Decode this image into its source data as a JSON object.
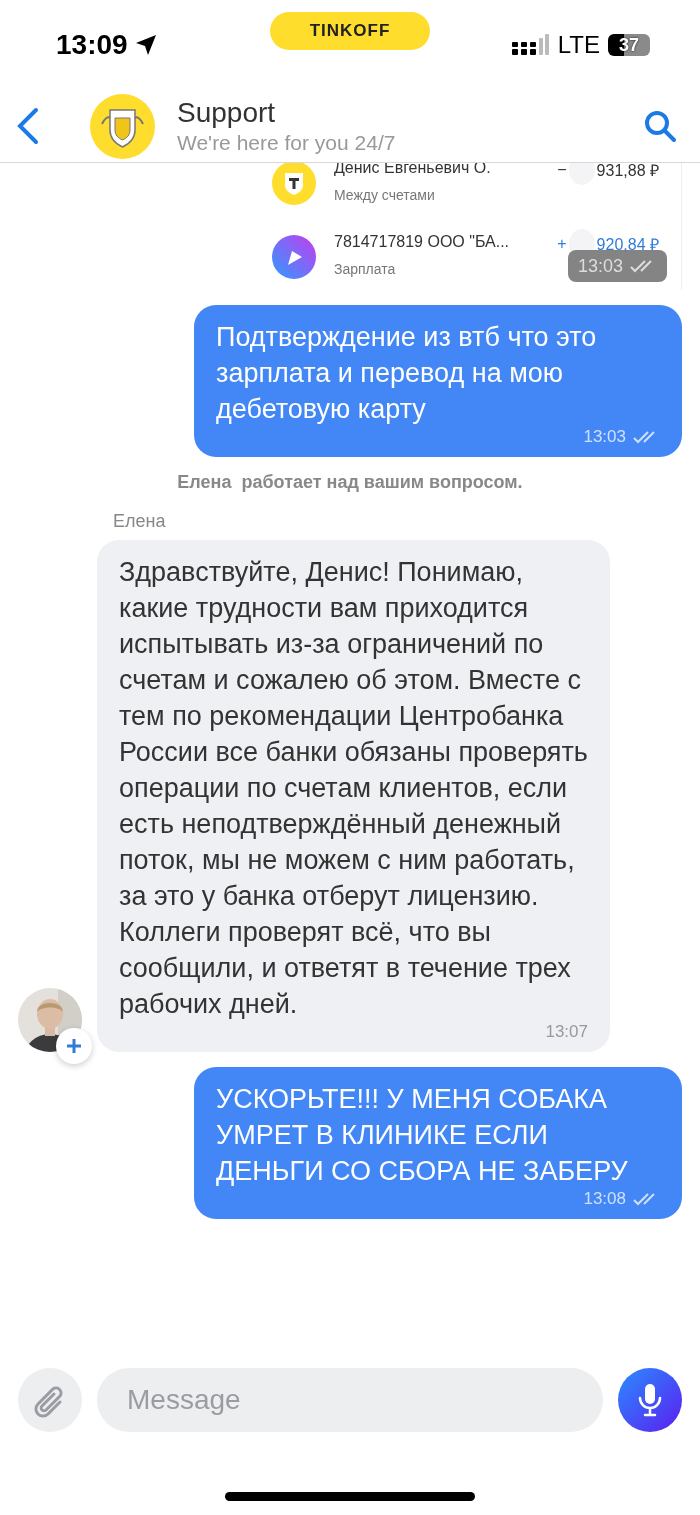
{
  "status_bar": {
    "time": "13:09",
    "carrier_badge": "TINKOFF",
    "network": "LTE",
    "battery": "37"
  },
  "header": {
    "title": "Support",
    "subtitle": "We're here for you 24/7"
  },
  "messages": [
    {
      "time": "13:03",
      "read": true,
      "transactions": [
        {
          "kind": "bank",
          "name": "Денис Евгеньевич О.",
          "category": "Между счетами",
          "sign": "−",
          "amount": "931,88 ₽",
          "color": "#333333"
        },
        {
          "kind": "play",
          "name": "7814717819 ООО \"БА...",
          "category": "Зарплата",
          "sign": "+",
          "amount": "920,84 ₽",
          "color": "#2f7cd9"
        }
      ]
    },
    {
      "kind": "outgoing",
      "text": "Подтверждение из втб что это зарплата и перевод на мою дебетовую карту",
      "time": "13:03",
      "read": true
    },
    {
      "kind": "system",
      "text": "Елена  работает над вашим вопросом."
    },
    {
      "kind": "incoming",
      "sender": "Елена",
      "text": "Здравствуйте, Денис! Понимаю, какие трудности вам приходится испытывать из-за ограничений по счетам и сожалею об этом. Вместе с тем по рекомендации Центробанка России все банки обязаны проверять операции по счетам клиентов, если есть неподтверждённый денежный поток, мы не можем с ним работать, за это у банка отберут лицензию.\nКоллеги проверят всё, что вы сообщили, и ответят в течение трех рабочих дней.",
      "time": "13:07"
    },
    {
      "kind": "outgoing",
      "text": "УСКОРЬТЕ!!! У МЕНЯ СОБАКА УМРЕТ В КЛИНИКЕ ЕСЛИ ДЕНЬГИ СО СБОРА НЕ ЗАБЕРУ",
      "time": "13:08",
      "read": true
    }
  ],
  "composer": {
    "placeholder": "Message"
  }
}
